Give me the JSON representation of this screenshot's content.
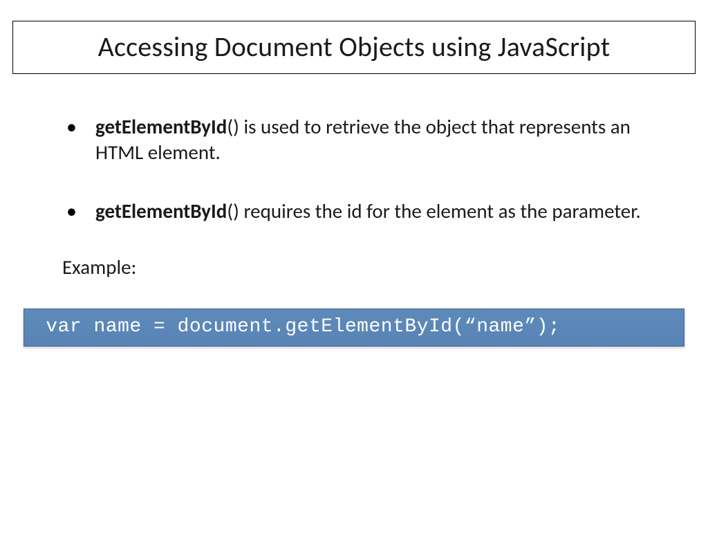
{
  "title": "Accessing Document Objects using JavaScript",
  "bullets": [
    {
      "bold": "getElementById",
      "rest": "() is used to retrieve the object that represents an HTML element."
    },
    {
      "bold": "getElementById",
      "rest": "() requires the id for the element as the parameter."
    }
  ],
  "exampleLabel": "Example:",
  "codeLine": " var name = document.getElementById(“name”);"
}
